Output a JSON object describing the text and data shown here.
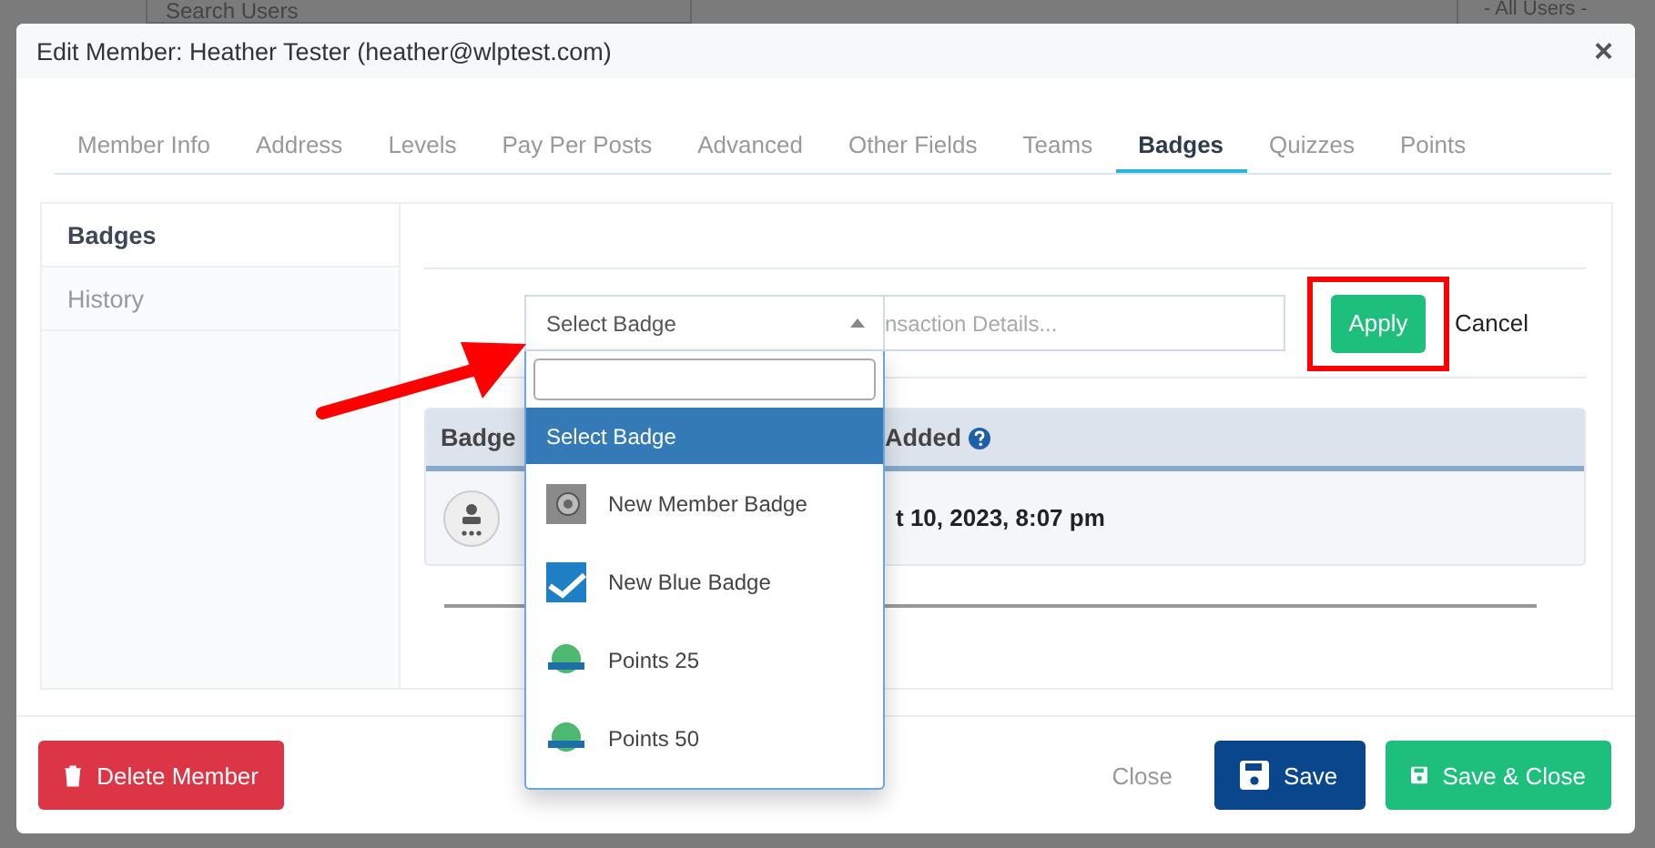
{
  "background": {
    "search_placeholder": "Search Users",
    "filter": "- All Users -"
  },
  "modal": {
    "title": "Edit Member: Heather Tester (heather@wlptest.com)",
    "close": "×"
  },
  "tabs": [
    {
      "label": "Member Info",
      "selected": false
    },
    {
      "label": "Address",
      "selected": false
    },
    {
      "label": "Levels",
      "selected": false
    },
    {
      "label": "Pay Per Posts",
      "selected": false
    },
    {
      "label": "Advanced",
      "selected": false
    },
    {
      "label": "Other Fields",
      "selected": false
    },
    {
      "label": "Teams",
      "selected": false
    },
    {
      "label": "Badges",
      "selected": true
    },
    {
      "label": "Quizzes",
      "selected": false
    },
    {
      "label": "Points",
      "selected": false
    }
  ],
  "side_menu": [
    {
      "label": "Badges",
      "selected": true
    },
    {
      "label": "History",
      "selected": false
    }
  ],
  "badge_form": {
    "select": {
      "value": "Select Badge",
      "expanded": true
    },
    "details": {
      "placeholder": "nsaction Details..."
    },
    "apply": "Apply",
    "cancel": "Cancel"
  },
  "dropdown_options": [
    {
      "label": "Select Badge",
      "selected": true,
      "kind": "plain"
    },
    {
      "label": "New Member Badge",
      "selected": false,
      "kind": "photo"
    },
    {
      "label": "New Blue Badge",
      "selected": false,
      "kind": "check"
    },
    {
      "label": "Points 25",
      "selected": false,
      "kind": "points"
    },
    {
      "label": "Points 50",
      "selected": false,
      "kind": "points"
    }
  ],
  "table": {
    "columns": [
      "Badge",
      "Added"
    ],
    "rows": [
      {
        "date": "t 10, 2023, 8:07 pm"
      }
    ]
  },
  "footer": {
    "delete": "Delete Member",
    "close": "Close",
    "save": "Save",
    "save_close": "Save & Close"
  }
}
